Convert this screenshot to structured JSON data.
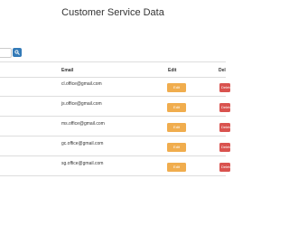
{
  "page": {
    "title": "Customer Service Data"
  },
  "search": {
    "value": "",
    "button_icon": "search-icon",
    "button_color": "#337ab7"
  },
  "table": {
    "columns": [
      "Email",
      "Edit",
      "Del"
    ],
    "edit_label": "Edit",
    "delete_label": "Delete",
    "edit_color": "#f0ad4e",
    "delete_color": "#d9534f",
    "rows": [
      {
        "email": "cl.office@gmail.com"
      },
      {
        "email": "js.office@gmail.com"
      },
      {
        "email": "ms.office@gmail.com"
      },
      {
        "email": "gc.office@gmail.com"
      },
      {
        "email": "sg.office@gmail.com"
      }
    ]
  }
}
